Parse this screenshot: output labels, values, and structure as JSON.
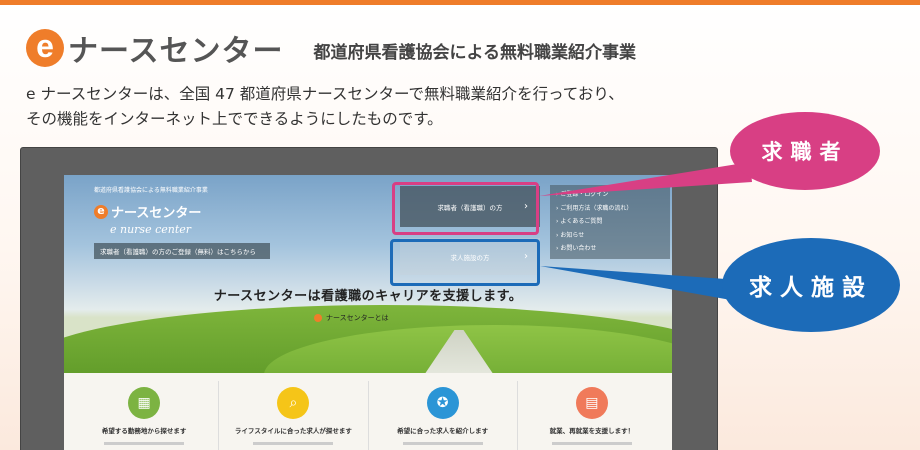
{
  "header": {
    "logo_letter": "e",
    "logo_text": "ナースセンター",
    "tagline": "都道府県看護協会による無料職業紹介事業"
  },
  "description": {
    "line1": "e ナースセンターは、全国 47 都道府県ナースセンターで無料職業紹介を行っており、",
    "line2": "その機能をインターネット上でできるようにしたものです。"
  },
  "screen": {
    "org_text": "都道府県看護協会による無料職業紹介事業",
    "logo_letter": "e",
    "logo_text": "ナースセンター",
    "logo_script": "e nurse center",
    "register_button": "求職者（看護職）の方のご登録（無料）はこちらから",
    "nav_job_seeker": "求職者（看護職）の方",
    "nav_facility": "求人施設の方",
    "menu_items": [
      "ご登録・ログイン",
      "ご利用方法（求職の流れ）",
      "よくあるご質問",
      "お知らせ",
      "お問い合わせ"
    ],
    "catchphrase": "ナースセンターは看護職のキャリアを支援します。",
    "about_link": "ナースセンターとは",
    "features": [
      {
        "label": "希望する勤務地から探せます",
        "icon": "map-icon",
        "color": "#7cb342"
      },
      {
        "label": "ライフスタイルに合った求人が探せます",
        "icon": "search-icon",
        "color": "#f5c518"
      },
      {
        "label": "希望に合った求人を紹介します",
        "icon": "award-icon",
        "color": "#2b95d6"
      },
      {
        "label": "就業、再就業を支援します！",
        "icon": "card-icon",
        "color": "#f07a5a"
      }
    ]
  },
  "callouts": {
    "job_seeker": "求職者",
    "facility": "求人施設"
  },
  "colors": {
    "brand_orange": "#ef7d2a",
    "pink": "#d83f84",
    "blue": "#1c6bb8"
  }
}
